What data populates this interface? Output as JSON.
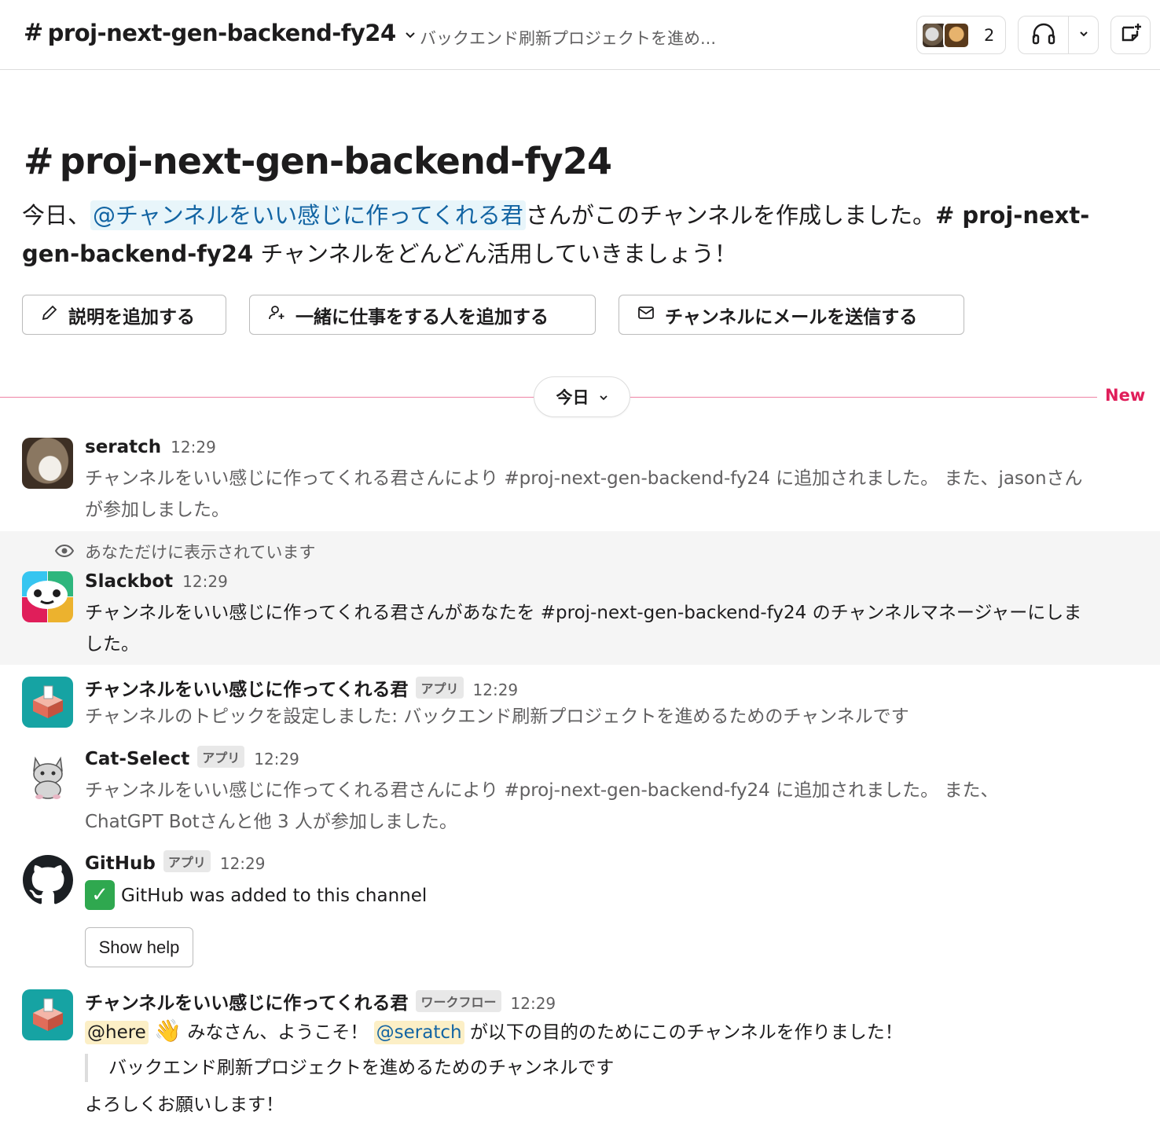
{
  "header": {
    "channel_name": "proj-next-gen-backend-fy24",
    "topic": "バックエンド刷新プロジェクトを進め...",
    "member_count": "2"
  },
  "intro": {
    "title": "proj-next-gen-backend-fy24",
    "text_prefix": "今日、",
    "creator_mention": "@チャンネルをいい感じに作ってくれる君",
    "text_middle": "さんがこのチャンネルを作成しました。",
    "channel_ref": "# proj-next-gen-backend-fy24",
    "text_suffix": " チャンネルをどんどん活用していきましょう！",
    "buttons": {
      "add_description": "説明を追加する",
      "add_people": "一緒に仕事をする人を追加する",
      "send_email": "チャンネルにメールを送信する"
    }
  },
  "divider": {
    "day_label": "今日",
    "new_label": "New"
  },
  "messages": [
    {
      "name": "seratch",
      "time": "12:29",
      "body_line1": "チャンネルをいい感じに作ってくれる君さんにより #proj-next-gen-backend-fy24 に追加されました。 また、jasonさん",
      "body_line2": "が参加しました。"
    },
    {
      "ephemeral_note": "あなただけに表示されています",
      "name": "Slackbot",
      "time": "12:29",
      "body_line1": "チャンネルをいい感じに作ってくれる君さんがあなたを #proj-next-gen-backend-fy24 のチャンネルマネージャーにしま",
      "body_line2": "した。"
    },
    {
      "name": "チャンネルをいい感じに作ってくれる君",
      "badge": "アプリ",
      "time": "12:29",
      "body_line1": "チャンネルのトピックを設定しました: バックエンド刷新プロジェクトを進めるためのチャンネルです"
    },
    {
      "name": "Cat-Select",
      "badge": "アプリ",
      "time": "12:29",
      "body_line1": "チャンネルをいい感じに作ってくれる君さんにより #proj-next-gen-backend-fy24 に追加されました。 また、",
      "body_line2": "ChatGPT Botさんと他 3 人が参加しました。"
    },
    {
      "name": "GitHub",
      "badge": "アプリ",
      "time": "12:29",
      "body_line1": "GitHub was added to this channel",
      "button": "Show help"
    },
    {
      "name": "チャンネルをいい感じに作ってくれる君",
      "badge": "ワークフロー",
      "time": "12:29",
      "here_mention": "@here",
      "text_a": " みなさん、ようこそ！ ",
      "user_mention": "@seratch",
      "text_b": " が以下の目的のためにこのチャンネルを作りました！",
      "quote": "バックエンド刷新プロジェクトを進めるためのチャンネルです",
      "closing": "よろしくお願いします！"
    }
  ],
  "icons": [
    "chevron-down-icon",
    "headphones-icon",
    "canvas-icon",
    "pencil-icon",
    "add-person-icon",
    "email-icon",
    "eye-icon",
    "check-icon",
    "wave-emoji-icon",
    "github-icon"
  ],
  "colors": {
    "new_line": "#e01e5a",
    "mention_bg": "#e8f5fa",
    "mention_text": "#1264a3",
    "here_bg": "#fcefc6",
    "ephemeral_bg": "#f5f5f5"
  }
}
